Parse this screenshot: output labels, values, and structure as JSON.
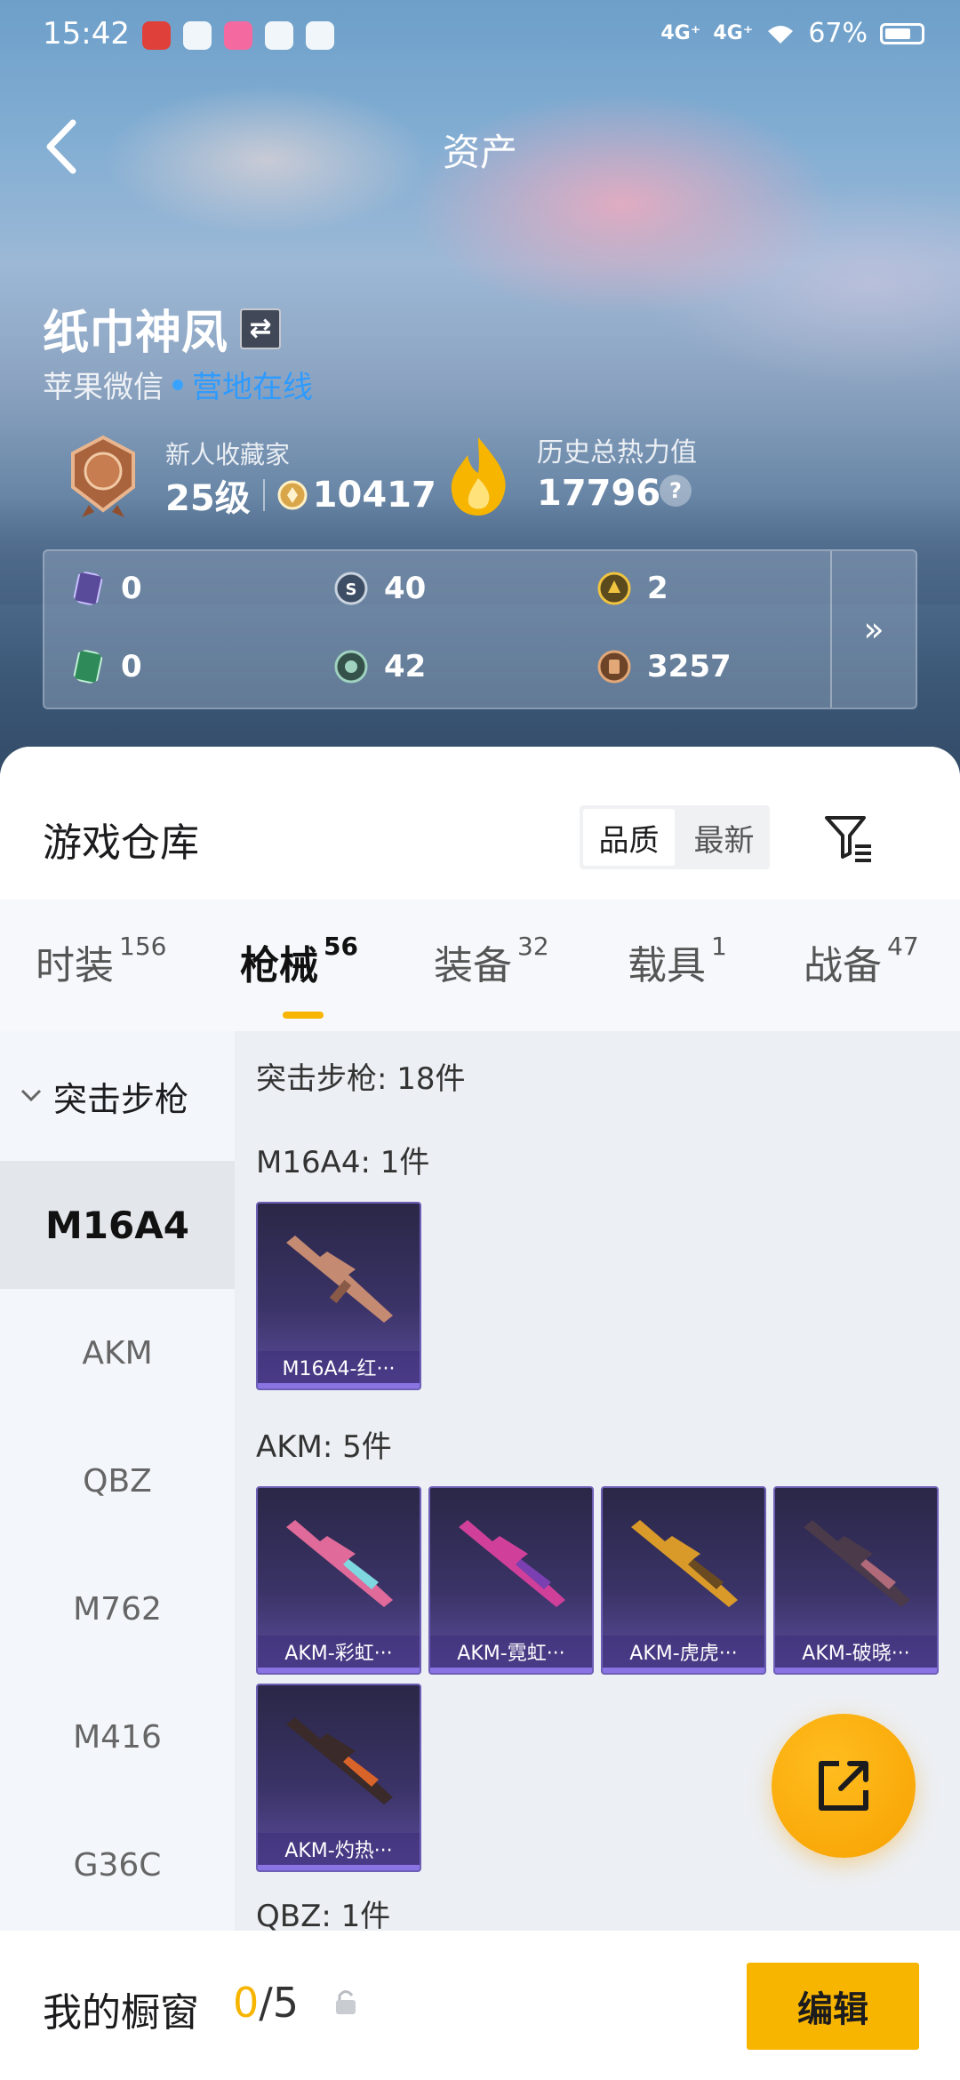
{
  "status_bar": {
    "time": "15:42",
    "signal1": "4G⁺",
    "signal2": "4G⁺",
    "battery": "67%"
  },
  "header": {
    "title": "资产"
  },
  "profile": {
    "name": "纸巾神凤",
    "platform": "苹果微信",
    "online_status": "营地在线",
    "collector_title": "新人收藏家",
    "level": "25级",
    "collection_points": "10417",
    "heat_caption": "历史总热力值",
    "heat_value": "17796",
    "help": "?"
  },
  "resources": [
    {
      "icon": "card-purple-icon",
      "value": "0"
    },
    {
      "icon": "silver-coin-icon",
      "value": "40"
    },
    {
      "icon": "gold-coin-icon",
      "value": "2"
    },
    {
      "icon": "card-green-icon",
      "value": "0"
    },
    {
      "icon": "green-coin-icon",
      "value": "42"
    },
    {
      "icon": "bronze-coin-icon",
      "value": "3257"
    }
  ],
  "resources_more": "»",
  "warehouse": {
    "title": "游戏仓库",
    "sort_options": [
      "品质",
      "最新"
    ],
    "sort_active": "品质"
  },
  "tabs": [
    {
      "label": "时装",
      "count": "156"
    },
    {
      "label": "枪械",
      "count": "56"
    },
    {
      "label": "装备",
      "count": "32"
    },
    {
      "label": "载具",
      "count": "1"
    },
    {
      "label": "战备",
      "count": "47"
    }
  ],
  "sidebar": {
    "category": "突击步枪",
    "items": [
      "M16A4",
      "AKM",
      "QBZ",
      "M762",
      "M416",
      "G36C"
    ],
    "active": "M16A4"
  },
  "content": {
    "category_header": "突击步枪: 18件",
    "groups": [
      {
        "header": "M16A4: 1件",
        "items": [
          "M16A4-红···"
        ]
      },
      {
        "header": "AKM: 5件",
        "items": [
          "AKM-彩虹···",
          "AKM-霓虹···",
          "AKM-虎虎···",
          "AKM-破晓···",
          "AKM-灼热···"
        ]
      },
      {
        "header": "QBZ: 1件",
        "items": []
      }
    ]
  },
  "showcase": {
    "label": "我的橱窗",
    "current": "0",
    "total": "/5"
  },
  "edit_button": "编辑",
  "colors": {
    "accent": "#f7b500",
    "online": "#2e9bff",
    "tile_bg": "#3a3366"
  }
}
